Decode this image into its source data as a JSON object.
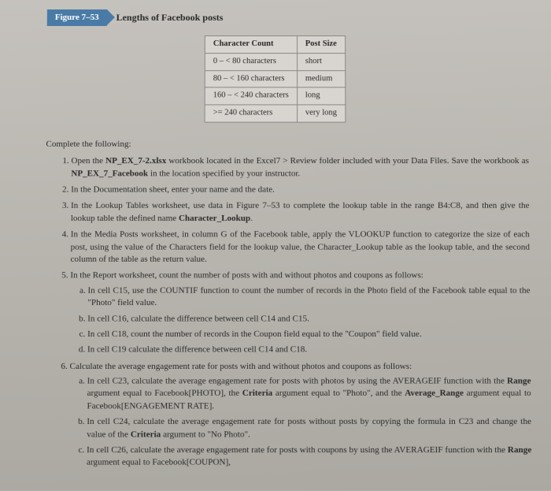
{
  "figure": {
    "tag": "Figure 7–53",
    "title": "Lengths of Facebook posts"
  },
  "chart_data": {
    "type": "table",
    "title": "Lengths of Facebook posts",
    "columns": [
      "Character Count",
      "Post Size"
    ],
    "rows": [
      [
        "0 – < 80 characters",
        "short"
      ],
      [
        "80 – < 160 characters",
        "medium"
      ],
      [
        "160 – < 240 characters",
        "long"
      ],
      [
        ">= 240 characters",
        "very long"
      ]
    ]
  },
  "heading": "Complete the following:",
  "items": {
    "i1a": "Open the ",
    "i1b": "NP_EX_7-2.xlsx",
    "i1c": " workbook located in the Excel7 > Review folder included with your Data Files. Save the workbook as ",
    "i1d": "NP_EX_7_Facebook",
    "i1e": " in the location specified by your instructor.",
    "i2": "In the Documentation sheet, enter your name and the date.",
    "i3a": "In the Lookup Tables worksheet, use data in Figure 7–53 to complete the lookup table in the range B4:C8, and then give the lookup table the defined name ",
    "i3b": "Character_Lookup",
    "i3c": ".",
    "i4": "In the Media Posts worksheet, in column G of the Facebook table, apply the VLOOKUP function to categorize the size of each post, using the value of the Characters field for the lookup value, the Character_Lookup table as the lookup table, and the second column of the table as the return value.",
    "i5": "In the Report worksheet, count the number of posts with and without photos and coupons as follows:",
    "i5a": "In cell C15, use the COUNTIF function to count the number of records in the Photo field of the Facebook table equal to the \"Photo\" field value.",
    "i5b": "In cell C16, calculate the difference between cell C14 and C15.",
    "i5c": "In cell C18, count the number of records in the Coupon field equal to the \"Coupon\" field value.",
    "i5d": "In cell C19 calculate the difference between cell C14 and C18.",
    "i6": "Calculate the average engagement rate for posts with and without photos and coupons as follows:",
    "i6a_1": "In cell C23, calculate the average engagement rate for posts with photos by using the AVERAGEIF function with the ",
    "i6a_2": "Range",
    "i6a_3": " argument equal to Facebook[PHOTO], the ",
    "i6a_4": "Criteria",
    "i6a_5": " argument equal to \"Photo\", and the ",
    "i6a_6": "Average_Range",
    "i6a_7": " argument equal to Facebook[ENGAGEMENT RATE].",
    "i6b_1": "In cell C24, calculate the average engagement rate for posts without posts by copying the formula in C23 and change the value of the ",
    "i6b_2": "Criteria",
    "i6b_3": " argument to \"No Photo\".",
    "i6c_1": "In cell C26, calculate the average engagement rate for posts with coupons by using the AVERAGEIF function with the ",
    "i6c_2": "Range",
    "i6c_3": " argument equal to Facebook[COUPON],"
  }
}
